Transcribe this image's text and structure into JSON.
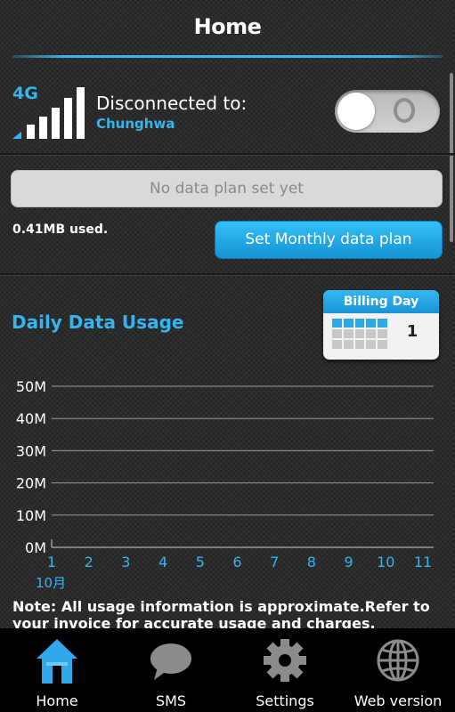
{
  "header": {
    "title": "Home"
  },
  "connection": {
    "network_type": "4G",
    "status": "Disconnected to:",
    "carrier": "Chunghwa",
    "toggle_state": "off",
    "signal_bars": 5
  },
  "data_plan": {
    "plan_placeholder": "No data plan set yet",
    "used_text": "0.41MB used.",
    "set_plan_label": "Set Monthly data plan"
  },
  "usage": {
    "title": "Daily Data Usage",
    "billing_label": "Billing Day",
    "billing_day": "1"
  },
  "chart_data": {
    "type": "line",
    "title": "",
    "xlabel": "10月",
    "ylabel": "",
    "y_ticks": [
      "0M",
      "10M",
      "20M",
      "30M",
      "40M",
      "50M"
    ],
    "x_ticks": [
      "1",
      "2",
      "3",
      "4",
      "5",
      "6",
      "7",
      "8",
      "9",
      "10",
      "11"
    ],
    "ylim": [
      0,
      50
    ],
    "xlim": [
      1,
      11
    ],
    "grid": true,
    "series": []
  },
  "note": "Note: All usage information is approximate.Refer to your invoice for accurate usage and charges.",
  "bottom_nav": [
    {
      "label": "Home",
      "icon": "home-icon",
      "active": true
    },
    {
      "label": "SMS",
      "icon": "chat-bubble-icon",
      "active": false
    },
    {
      "label": "Settings",
      "icon": "gear-icon",
      "active": false
    },
    {
      "label": "Web version",
      "icon": "globe-icon",
      "active": false
    }
  ],
  "colors": {
    "accent": "#35b5f0",
    "inactive_icon": "#8c8c8c",
    "background": "#2b2b2b"
  }
}
